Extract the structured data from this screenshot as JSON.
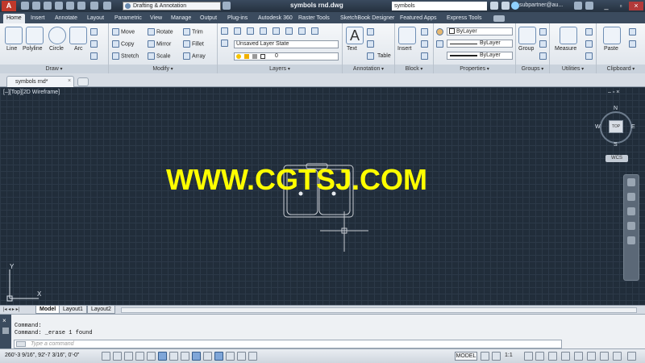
{
  "titlebar": {
    "logo": "A",
    "workspace": "Drafting & Annotation",
    "title": "symbols rnd.dwg",
    "search_value": "symbols",
    "user": "subpartner@au..."
  },
  "tabs": [
    "Home",
    "Insert",
    "Annotate",
    "Layout",
    "Parametric",
    "View",
    "Manage",
    "Output",
    "Plug-ins",
    "Autodesk 360",
    "Raster Tools",
    "SketchBook Designer",
    "Featured Apps",
    "Express Tools"
  ],
  "ribbon": {
    "draw": {
      "label": "Draw",
      "tools": [
        "Line",
        "Polyline",
        "Circle",
        "Arc"
      ]
    },
    "modify": {
      "label": "Modify",
      "tools": [
        "Move",
        "Rotate",
        "Trim",
        "Copy",
        "Mirror",
        "Fillet",
        "Stretch",
        "Scale",
        "Array"
      ]
    },
    "layers": {
      "label": "Layers",
      "layer_state": "Unsaved Layer State",
      "current_layer": "0"
    },
    "annotation": {
      "label": "Annotation",
      "text": "Text",
      "table": "Table"
    },
    "block": {
      "label": "Block",
      "insert": "Insert"
    },
    "properties": {
      "label": "Properties",
      "color": "ByLayer",
      "linetype": "ByLayer",
      "lineweight": "ByLayer"
    },
    "groups": {
      "label": "Groups",
      "group": "Group"
    },
    "utilities": {
      "label": "Utilities",
      "measure": "Measure"
    },
    "clipboard": {
      "label": "Clipboard",
      "paste": "Paste"
    }
  },
  "document": {
    "tab": "symbols rnd*"
  },
  "viewport": {
    "controls": "[–][Top][2D Wireframe]",
    "watermark": "WWW.CGTSJ.COM",
    "viewcube": {
      "n": "N",
      "s": "S",
      "e": "E",
      "w": "W",
      "top": "TOP",
      "wcs": "WCS"
    },
    "ucs": {
      "x": "X",
      "y": "Y"
    }
  },
  "layout_tabs": [
    "Model",
    "Layout1",
    "Layout2"
  ],
  "command": {
    "line1": "Command:",
    "line2": "Command: _erase 1 found",
    "placeholder": "Type a command"
  },
  "status": {
    "coords": "260'-3 9/16\", 92'-7 3/16\", 0'-0\"",
    "model": "MODEL",
    "scale": "1:1"
  }
}
